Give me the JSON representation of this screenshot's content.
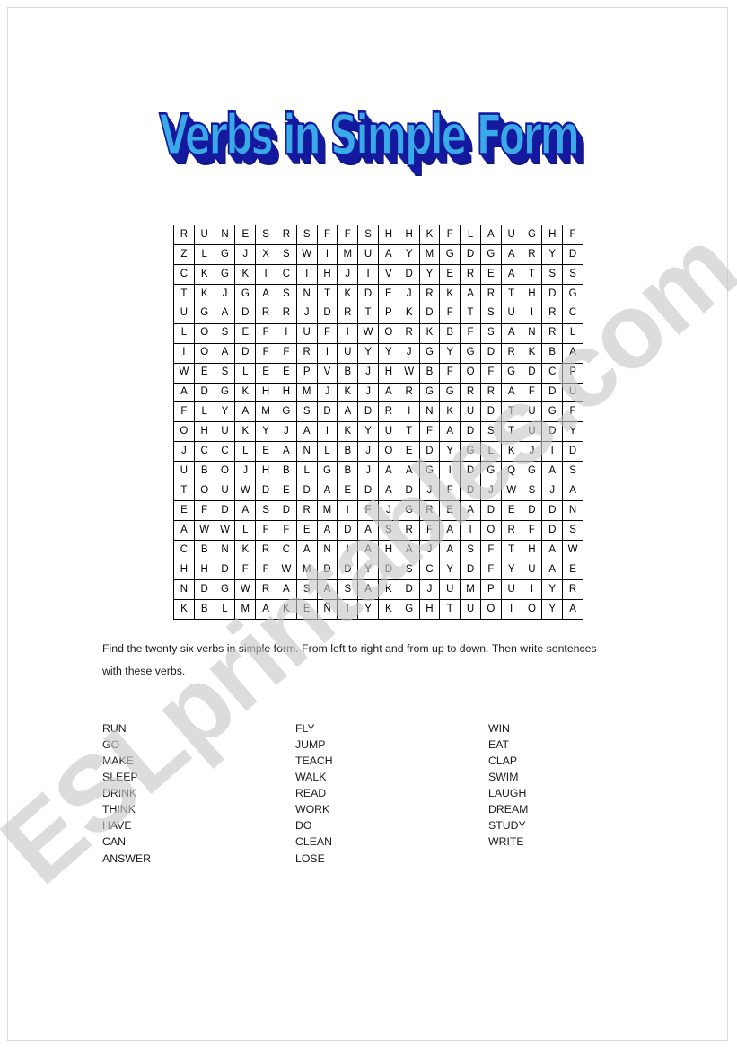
{
  "document": {
    "title": "Verbs in Simple Form",
    "watermark": "ESLprintables.com"
  },
  "instructions": {
    "text": "Find the twenty six verbs in simple form. From left to right and from up to down. Then write sentences with these verbs."
  },
  "grid": {
    "rows": 20,
    "cols": 20,
    "letters": [
      [
        "R",
        "U",
        "N",
        "E",
        "S",
        "R",
        "S",
        "F",
        "F",
        "S",
        "H",
        "H",
        "K",
        "F",
        "L",
        "A",
        "U",
        "G",
        "H",
        "F"
      ],
      [
        "Z",
        "L",
        "G",
        "J",
        "X",
        "S",
        "W",
        "I",
        "M",
        "U",
        "A",
        "Y",
        "M",
        "G",
        "D",
        "G",
        "A",
        "R",
        "Y",
        "D"
      ],
      [
        "C",
        "K",
        "G",
        "K",
        "I",
        "C",
        "I",
        "H",
        "J",
        "I",
        "V",
        "D",
        "Y",
        "E",
        "R",
        "E",
        "A",
        "T",
        "S",
        "S"
      ],
      [
        "T",
        "K",
        "J",
        "G",
        "A",
        "S",
        "N",
        "T",
        "K",
        "D",
        "E",
        "J",
        "R",
        "K",
        "A",
        "R",
        "T",
        "H",
        "D",
        "G"
      ],
      [
        "U",
        "G",
        "A",
        "D",
        "R",
        "R",
        "J",
        "D",
        "R",
        "T",
        "P",
        "K",
        "D",
        "F",
        "T",
        "S",
        "U",
        "I",
        "R",
        "C"
      ],
      [
        "L",
        "O",
        "S",
        "E",
        "F",
        "I",
        "U",
        "F",
        "I",
        "W",
        "O",
        "R",
        "K",
        "B",
        "F",
        "S",
        "A",
        "N",
        "R",
        "L"
      ],
      [
        "I",
        "O",
        "A",
        "D",
        "F",
        "F",
        "R",
        "I",
        "U",
        "Y",
        "Y",
        "J",
        "G",
        "Y",
        "G",
        "D",
        "R",
        "K",
        "B",
        "A"
      ],
      [
        "W",
        "E",
        "S",
        "L",
        "E",
        "E",
        "P",
        "V",
        "B",
        "J",
        "H",
        "W",
        "B",
        "F",
        "O",
        "F",
        "G",
        "D",
        "C",
        "P"
      ],
      [
        "A",
        "D",
        "G",
        "K",
        "H",
        "H",
        "M",
        "J",
        "K",
        "J",
        "A",
        "R",
        "G",
        "G",
        "R",
        "R",
        "A",
        "F",
        "D",
        "U"
      ],
      [
        "F",
        "L",
        "Y",
        "A",
        "M",
        "G",
        "S",
        "D",
        "A",
        "D",
        "R",
        "I",
        "N",
        "K",
        "U",
        "D",
        "T",
        "U",
        "G",
        "F"
      ],
      [
        "O",
        "H",
        "U",
        "K",
        "Y",
        "J",
        "A",
        "I",
        "K",
        "Y",
        "U",
        "T",
        "F",
        "A",
        "D",
        "S",
        "T",
        "U",
        "D",
        "Y"
      ],
      [
        "J",
        "C",
        "C",
        "L",
        "E",
        "A",
        "N",
        "L",
        "B",
        "J",
        "O",
        "E",
        "D",
        "Y",
        "G",
        "L",
        "K",
        "J",
        "I",
        "D"
      ],
      [
        "U",
        "B",
        "O",
        "J",
        "H",
        "B",
        "L",
        "G",
        "B",
        "J",
        "A",
        "A",
        "G",
        "I",
        "D",
        "G",
        "Q",
        "G",
        "A",
        "S"
      ],
      [
        "T",
        "O",
        "U",
        "W",
        "D",
        "E",
        "D",
        "A",
        "E",
        "D",
        "A",
        "D",
        "J",
        "F",
        "D",
        "J",
        "W",
        "S",
        "J",
        "A"
      ],
      [
        "E",
        "F",
        "D",
        "A",
        "S",
        "D",
        "R",
        "M",
        "I",
        "F",
        "J",
        "G",
        "R",
        "E",
        "A",
        "D",
        "E",
        "D",
        "D",
        "N"
      ],
      [
        "A",
        "W",
        "W",
        "L",
        "F",
        "F",
        "E",
        "A",
        "D",
        "A",
        "S",
        "R",
        "F",
        "A",
        "I",
        "O",
        "R",
        "F",
        "D",
        "S"
      ],
      [
        "C",
        "B",
        "N",
        "K",
        "R",
        "C",
        "A",
        "N",
        "I",
        "A",
        "H",
        "A",
        "J",
        "A",
        "S",
        "F",
        "T",
        "H",
        "A",
        "W"
      ],
      [
        "H",
        "H",
        "D",
        "F",
        "F",
        "W",
        "M",
        "D",
        "D",
        "Y",
        "D",
        "S",
        "C",
        "Y",
        "D",
        "F",
        "Y",
        "U",
        "A",
        "E"
      ],
      [
        "N",
        "D",
        "G",
        "W",
        "R",
        "A",
        "S",
        "A",
        "S",
        "A",
        "K",
        "D",
        "J",
        "U",
        "M",
        "P",
        "U",
        "I",
        "Y",
        "R"
      ],
      [
        "K",
        "B",
        "L",
        "M",
        "A",
        "K",
        "E",
        "Ñ",
        "I",
        "Y",
        "K",
        "G",
        "H",
        "T",
        "U",
        "O",
        "I",
        "O",
        "Y",
        "A"
      ]
    ]
  },
  "word_list": {
    "columns": [
      [
        "RUN",
        "GO",
        "MAKE",
        "SLEEP",
        "DRINK",
        "THINK",
        "HAVE",
        "CAN",
        "ANSWER"
      ],
      [
        "FLY",
        "JUMP",
        "TEACH",
        "WALK",
        "READ",
        "WORK",
        "DO",
        "CLEAN",
        "LOSE"
      ],
      [
        "WIN",
        "EAT",
        "CLAP",
        "SWIM",
        "LAUGH",
        "DREAM",
        "STUDY",
        "WRITE"
      ]
    ]
  },
  "colors": {
    "title_fill": "#3aa9e8",
    "title_shadow": "#14199e",
    "grid_line": "#000000",
    "text": "#1a1a1a",
    "watermark": "#c8c8c8"
  }
}
